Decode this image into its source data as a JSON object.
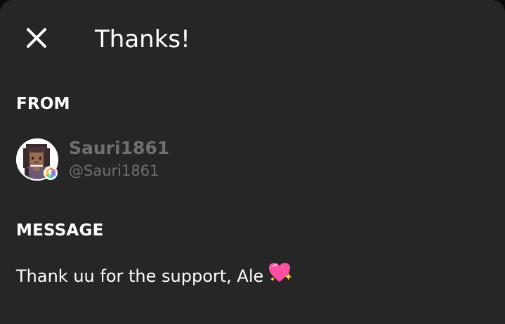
{
  "header": {
    "title": "Thanks!",
    "close_icon": "close-icon"
  },
  "from": {
    "label": "FROM",
    "display_name": "Sauri1861",
    "handle": "@Sauri1861",
    "avatar_icon": "pixel-avatar",
    "badge_icon": "hexagon-badge-icon"
  },
  "message": {
    "label": "MESSAGE",
    "text": "Thank uu for the support, Ale",
    "emoji_icon": "sparkling-heart-icon"
  },
  "colors": {
    "background": "#262626",
    "text": "#ffffff",
    "muted_text": "#6f6f6f"
  }
}
